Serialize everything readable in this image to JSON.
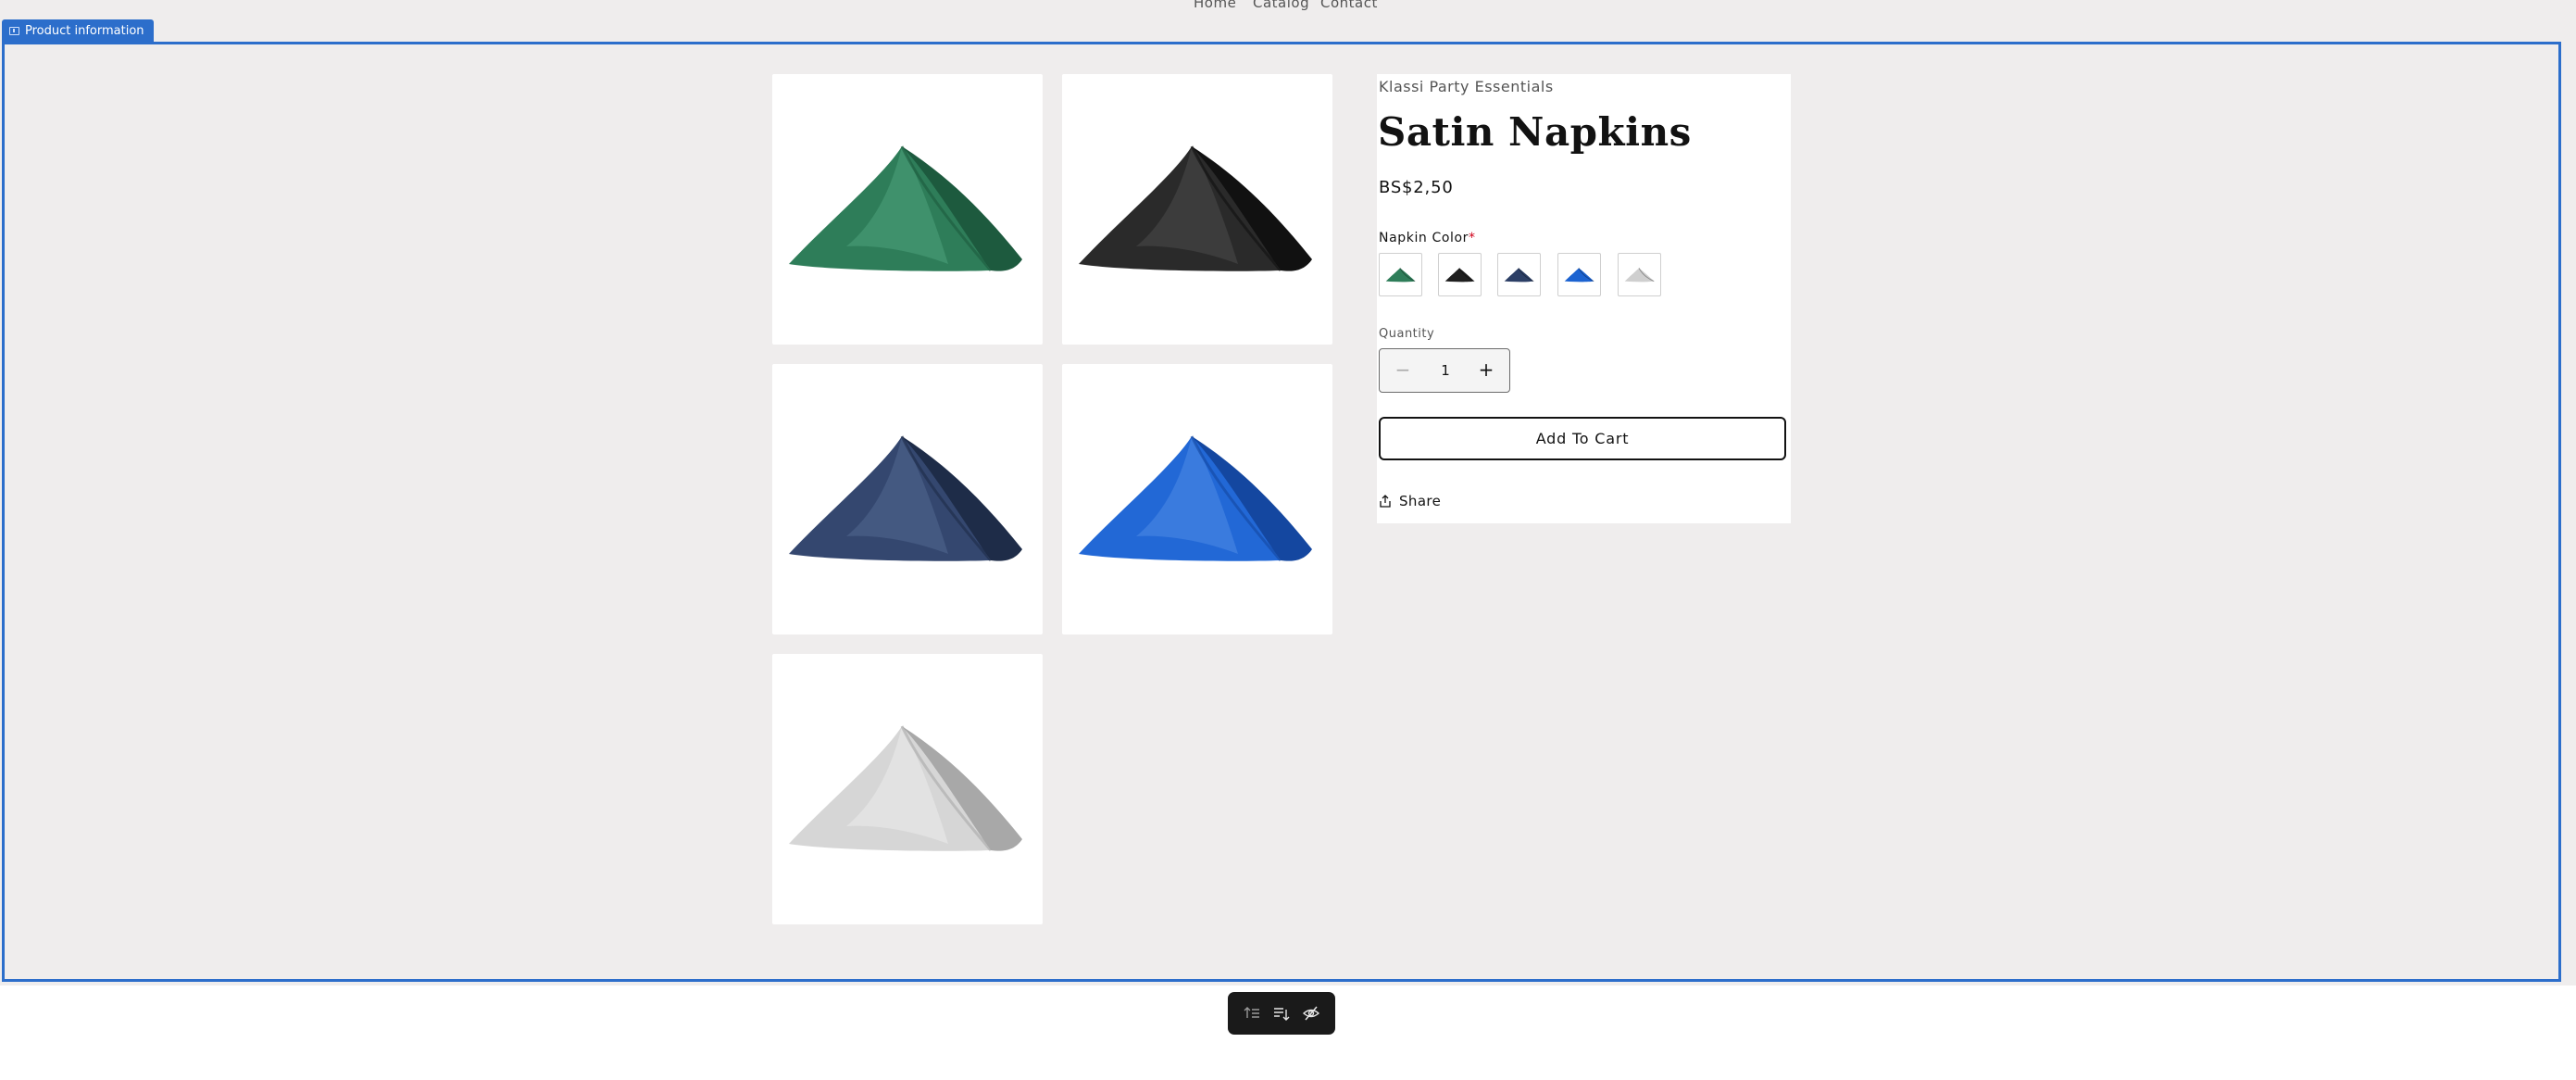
{
  "nav": {
    "items": [
      "Home",
      "Catalog",
      "Contact"
    ]
  },
  "section": {
    "label": "Product information"
  },
  "product": {
    "vendor": "Klassi Party Essentials",
    "title": "Satin Napkins",
    "price": "BS$2,50",
    "option_label": "Napkin Color",
    "required_mark": "*",
    "swatches": [
      {
        "color": "#2e7d59",
        "icon": "green-napkin"
      },
      {
        "color": "#1f1f1f",
        "icon": "black-napkin"
      },
      {
        "color": "#2c3f66",
        "icon": "navy-napkin"
      },
      {
        "color": "#1c63d1",
        "icon": "royal-blue-napkin"
      },
      {
        "color": "#cfcfcf",
        "icon": "silver-napkin"
      }
    ],
    "quantity_label": "Quantity",
    "quantity_value": "1",
    "minus_glyph": "−",
    "plus_glyph": "+",
    "add_to_cart": "Add To Cart",
    "share": "Share"
  },
  "gallery": [
    {
      "alt": "green napkin",
      "color": "#2e7d59",
      "dark": "#1d5a3e",
      "light": "#4fa37b"
    },
    {
      "alt": "black napkin",
      "color": "#2a2a2a",
      "dark": "#111111",
      "light": "#4a4a4a"
    },
    {
      "alt": "navy napkin",
      "color": "#34476f",
      "dark": "#1e2c48",
      "light": "#52678f"
    },
    {
      "alt": "royal blue napkin",
      "color": "#2268d6",
      "dark": "#1447a0",
      "light": "#4f8ae6"
    },
    {
      "alt": "silver napkin",
      "color": "#d6d6d6",
      "dark": "#a8a8a8",
      "light": "#ececec"
    }
  ],
  "toolbar": {
    "icons": [
      "move-up-icon",
      "move-down-icon",
      "hide-icon"
    ]
  }
}
